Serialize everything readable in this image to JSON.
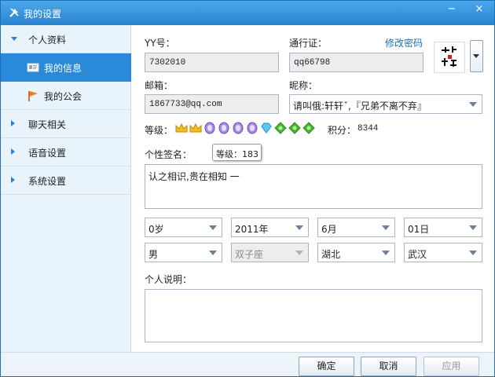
{
  "window": {
    "title": "我的设置",
    "minimize_glyph": "−",
    "close_glyph": "×"
  },
  "sidebar": {
    "sections": [
      {
        "label": "个人资料",
        "expanded": true
      },
      {
        "label": "聊天相关",
        "expanded": false
      },
      {
        "label": "语音设置",
        "expanded": false
      },
      {
        "label": "系统设置",
        "expanded": false
      }
    ],
    "sub_items": [
      {
        "label": "我的信息",
        "icon": "id-card-icon",
        "active": true
      },
      {
        "label": "我的公会",
        "icon": "flag-icon",
        "active": false
      }
    ]
  },
  "form": {
    "yy_label": "YY号：",
    "yy_value": "7302010",
    "passport_label": "通行证：",
    "passport_value": "qq66798",
    "change_password": "修改密码",
    "email_label": "邮箱：",
    "email_value": "1867733@qq.com",
    "nickname_label": "昵称：",
    "nickname_value": "请叫俄:轩轩ˇ,『兄弟不离不弃』",
    "level_label": "等级：",
    "points_label": "积分：",
    "points_value": "8344",
    "signature_label": "个性签名：",
    "signature_value": "认之相识,贵在相知  一",
    "tooltip": "等级：183",
    "age": "0岁",
    "year": "2011年",
    "month": "6月",
    "day": "01日",
    "gender": "男",
    "zodiac": "双子座",
    "province": "湖北",
    "city": "武汉",
    "description_label": "个人说明：",
    "description_value": ""
  },
  "level_badges": [
    "crown-icon",
    "crown-icon",
    "moon-icon",
    "moon-icon",
    "moon-icon",
    "moon-icon",
    "diamond-icon",
    "sun-icon",
    "sun-icon",
    "sun-icon"
  ],
  "footer": {
    "ok": "确定",
    "cancel": "取消",
    "apply": "应用"
  },
  "colors": {
    "accent": "#2a8ad9",
    "title_bar": "#2a83d0",
    "link": "#1f6fb4"
  }
}
